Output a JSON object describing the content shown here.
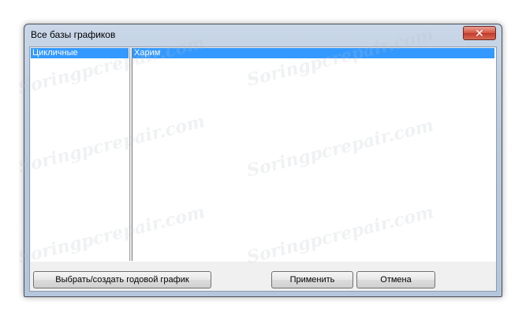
{
  "window": {
    "title": "Все базы графиков",
    "close_glyph": "✕"
  },
  "left_list": {
    "items": [
      "Цикличные"
    ],
    "selected_index": 0
  },
  "right_list": {
    "items": [
      "Харим"
    ],
    "selected_index": 0
  },
  "buttons": {
    "create_label": "Выбрать/создать годовой график",
    "apply_label": "Применить",
    "cancel_label": "Отмена"
  },
  "watermark_text": "Soringpcrepair.com",
  "colors": {
    "selection": "#3399ff",
    "close_button": "#c0392b"
  }
}
